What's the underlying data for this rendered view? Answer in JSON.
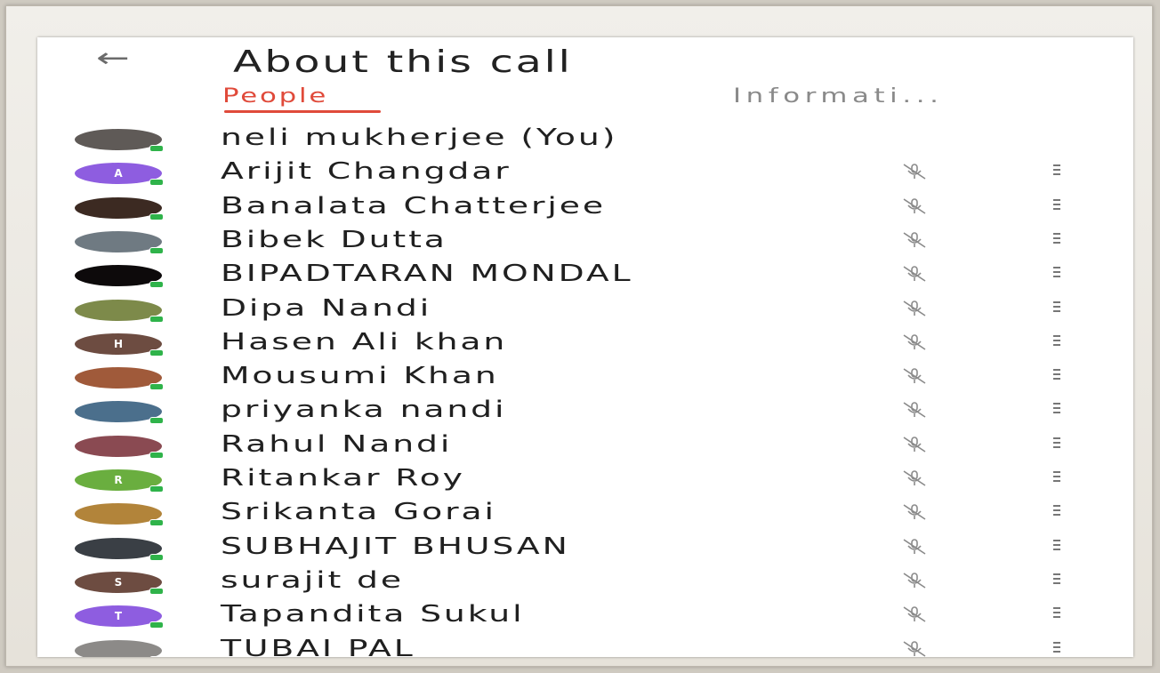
{
  "header": {
    "back_glyph": "←",
    "title": "About this call"
  },
  "tabs": [
    {
      "label": "People",
      "active": true
    },
    {
      "label": "Informati...",
      "active": false
    }
  ],
  "colors": {
    "accent": "#e04a3a",
    "online": "#2fb34a"
  },
  "participants": [
    {
      "name": "neli mukherjee (You)",
      "avatar_letter": "",
      "avatar_color": "#5f5a57",
      "show_controls": false
    },
    {
      "name": "Arijit Changdar",
      "avatar_letter": "A",
      "avatar_color": "#8e5de0",
      "show_controls": true
    },
    {
      "name": "Banalata Chatterjee",
      "avatar_letter": "",
      "avatar_color": "#3c2a22",
      "show_controls": true
    },
    {
      "name": "Bibek Dutta",
      "avatar_letter": "",
      "avatar_color": "#6f7a82",
      "show_controls": true
    },
    {
      "name": "BIPADTARAN MONDAL",
      "avatar_letter": "",
      "avatar_color": "#0d0a0b",
      "show_controls": true
    },
    {
      "name": "Dipa Nandi",
      "avatar_letter": "",
      "avatar_color": "#7d8a4a",
      "show_controls": true
    },
    {
      "name": "Hasen Ali khan",
      "avatar_letter": "H",
      "avatar_color": "#6d4c41",
      "show_controls": true
    },
    {
      "name": "Mousumi Khan",
      "avatar_letter": "",
      "avatar_color": "#a05a3a",
      "show_controls": true
    },
    {
      "name": "priyanka nandi",
      "avatar_letter": "",
      "avatar_color": "#4b6f8c",
      "show_controls": true
    },
    {
      "name": "Rahul Nandi",
      "avatar_letter": "",
      "avatar_color": "#8a4a52",
      "show_controls": true
    },
    {
      "name": "Ritankar Roy",
      "avatar_letter": "R",
      "avatar_color": "#6aae3f",
      "show_controls": true
    },
    {
      "name": "Srikanta Gorai",
      "avatar_letter": "",
      "avatar_color": "#b2843a",
      "show_controls": true
    },
    {
      "name": "SUBHAJIT BHUSAN",
      "avatar_letter": "",
      "avatar_color": "#3a3f45",
      "show_controls": true
    },
    {
      "name": "surajit de",
      "avatar_letter": "S",
      "avatar_color": "#6d4c41",
      "show_controls": true
    },
    {
      "name": "Tapandita Sukul",
      "avatar_letter": "T",
      "avatar_color": "#8e5de0",
      "show_controls": true
    },
    {
      "name": "TUBAI PAL",
      "avatar_letter": "",
      "avatar_color": "#8c8a88",
      "show_controls": true
    }
  ]
}
